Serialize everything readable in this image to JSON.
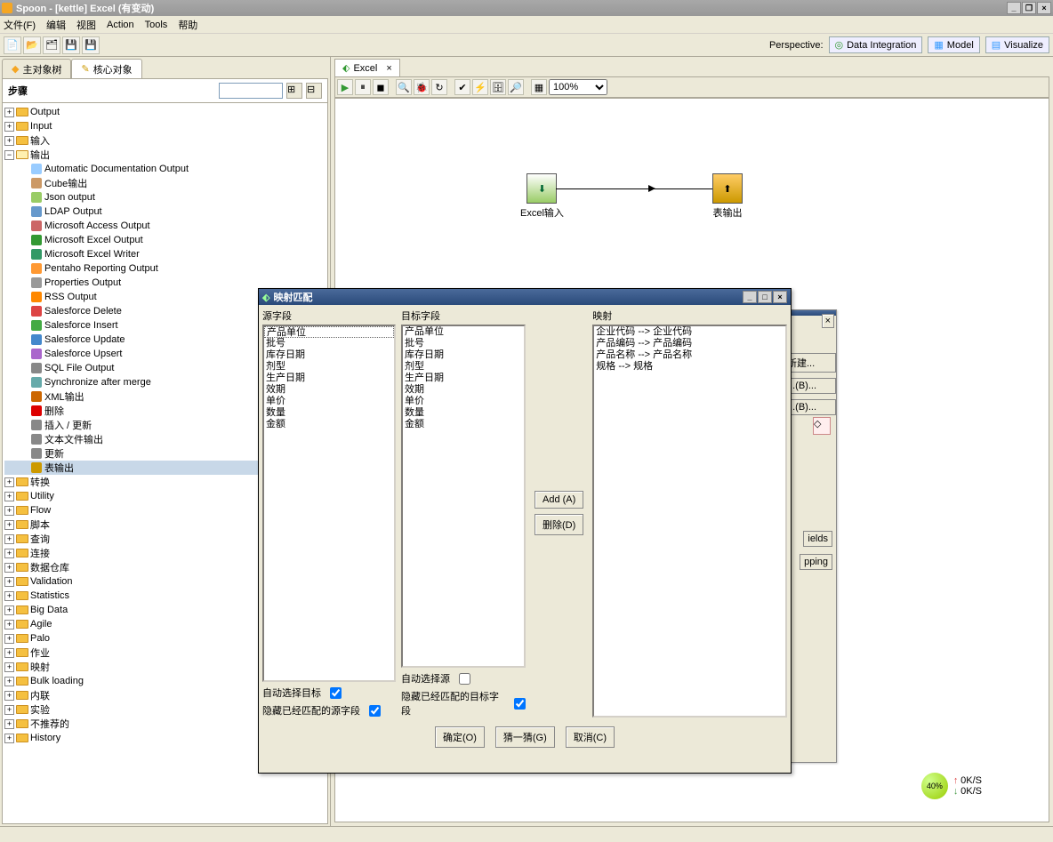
{
  "title": "Spoon - [kettle] Excel (有变动)",
  "menu": [
    "文件(F)",
    "编辑",
    "视图",
    "Action",
    "Tools",
    "帮助"
  ],
  "perspective_label": "Perspective:",
  "perspectives": [
    "Data Integration",
    "Model",
    "Visualize"
  ],
  "sidebar_tabs": [
    "主对象树",
    "核心对象"
  ],
  "steps_label": "步骤",
  "tree_top": [
    {
      "label": "Output"
    },
    {
      "label": "Input"
    },
    {
      "label": "输入"
    }
  ],
  "output_label": "输出",
  "output_children": [
    "Automatic Documentation Output",
    "Cube输出",
    "Json output",
    "LDAP Output",
    "Microsoft Access Output",
    "Microsoft Excel Output",
    "Microsoft Excel Writer",
    "Pentaho Reporting Output",
    "Properties Output",
    "RSS Output",
    "Salesforce Delete",
    "Salesforce Insert",
    "Salesforce Update",
    "Salesforce Upsert",
    "SQL File Output",
    "Synchronize after merge",
    "XML输出",
    "删除",
    "插入 / 更新",
    "文本文件输出",
    "更新",
    "表输出"
  ],
  "tree_rest": [
    "转换",
    "Utility",
    "Flow",
    "脚本",
    "查询",
    "连接",
    "数据仓库",
    "Validation",
    "Statistics",
    "Big Data",
    "Agile",
    "Palo",
    "作业",
    "映射",
    "Bulk loading",
    "内联",
    "实验",
    "不推荐的",
    "History"
  ],
  "canvas_tab": "Excel",
  "zoom": "100%",
  "step1": "Excel输入",
  "step2": "表输出",
  "dialog": {
    "title": "映射匹配",
    "src_label": "源字段",
    "tgt_label": "目标字段",
    "map_label": "映射",
    "src": [
      "产品单位",
      "批号",
      "库存日期",
      "剂型",
      "生产日期",
      "效期",
      "单价",
      "数量",
      "金额"
    ],
    "tgt": [
      "产品单位",
      "批号",
      "库存日期",
      "剂型",
      "生产日期",
      "效期",
      "单价",
      "数量",
      "金额"
    ],
    "mapping": [
      "企业代码 --> 企业代码",
      "产品编码 --> 产品编码",
      "产品名称 --> 产品名称",
      "规格 --> 规格"
    ],
    "add_btn": "Add (A)",
    "del_btn": "删除(D)",
    "auto_tgt": "自动选择目标",
    "hide_src": "隐藏已经匹配的源字段",
    "auto_src": "自动选择源",
    "hide_tgt": "隐藏已经匹配的目标字段",
    "ok": "确定(O)",
    "guess": "猜一猜(G)",
    "cancel": "取消(C)"
  },
  "bg_buttons": [
    "新建...",
    "...(B)...",
    "...(B)...",
    "ields",
    "pping"
  ],
  "speed": {
    "pct": "40%",
    "up": "0K/S",
    "down": "0K/S"
  }
}
